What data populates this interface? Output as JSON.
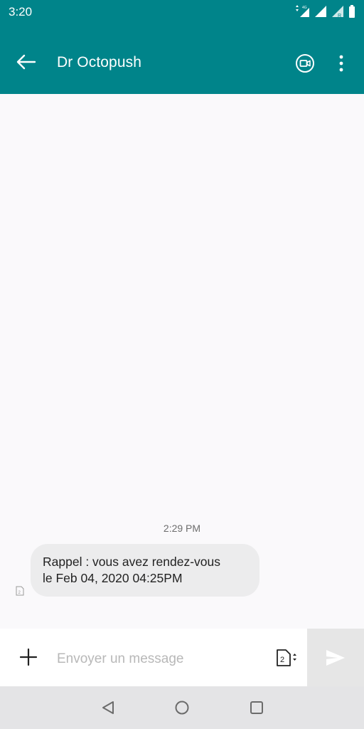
{
  "status_bar": {
    "time": "3:20",
    "icons": [
      "data-4g-icon",
      "signal-icon",
      "signal-r-icon",
      "battery-icon"
    ]
  },
  "app_bar": {
    "title": "Dr Octopush",
    "icons": [
      "back-arrow-icon",
      "video-call-icon",
      "more-vert-icon"
    ]
  },
  "thread": {
    "timestamp": "2:29 PM",
    "messages": [
      {
        "direction": "incoming",
        "text_line1": "Rappel : vous avez rendez-vous",
        "text_line2": "le Feb 04, 2020 04:25PM",
        "sim_icon": "sim-2-icon"
      }
    ]
  },
  "composer": {
    "placeholder": "Envoyer un message",
    "value": "",
    "sim_label": "2",
    "icons": [
      "plus-icon",
      "sim-2-switch-icon",
      "send-icon"
    ]
  },
  "nav_bar": {
    "icons": [
      "nav-back-icon",
      "nav-home-icon",
      "nav-recents-icon"
    ]
  },
  "colors": {
    "accent": "#00848a",
    "background": "#faf9fb",
    "bubble": "#ececed",
    "nav_bar": "#e4e4e6"
  }
}
